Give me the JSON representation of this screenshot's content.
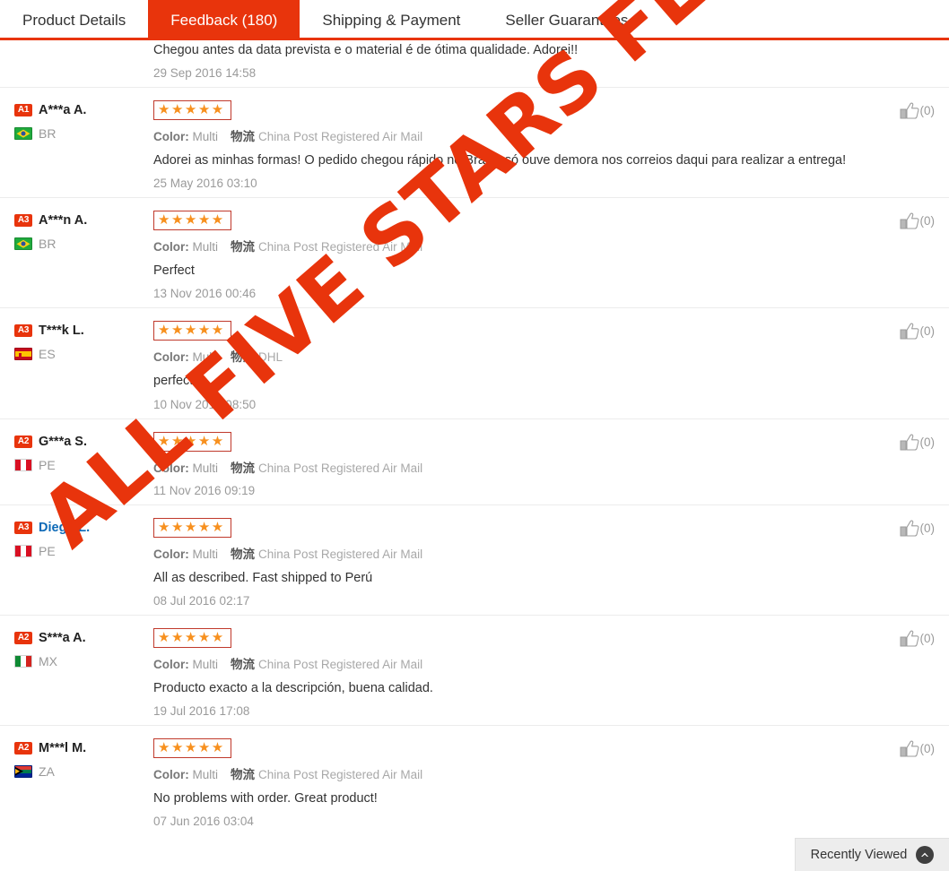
{
  "tabs": [
    {
      "label": "Product Details",
      "active": false
    },
    {
      "label": "Feedback (180)",
      "active": true
    },
    {
      "label": "Shipping & Payment",
      "active": false
    },
    {
      "label": "Seller Guarantees",
      "active": false
    }
  ],
  "watermark": {
    "text": "ALL FIVE STARS FEEEDBACK",
    "color": "#e8340c"
  },
  "recently_viewed": {
    "label": "Recently Viewed",
    "icon": "chevron-up-icon"
  },
  "accent_color": "#e8340c",
  "star_color": "#f7901e",
  "meta_labels": {
    "color_label": "Color:",
    "logistics_label": "物流"
  },
  "reviews": [
    {
      "partial": true,
      "badge": "",
      "user": "",
      "country": "",
      "flag": "",
      "stars": "",
      "color": "",
      "logistics": "",
      "text": "Chegou antes da data prevista e o material é de ótima qualidade. Adorei!!",
      "date": "29 Sep 2016 14:58",
      "helpful": ""
    },
    {
      "partial": false,
      "badge": "A1",
      "user": "A***a A.",
      "user_is_link": false,
      "country": "BR",
      "flag": "flag-br",
      "stars": "★★★★★",
      "color": "Multi",
      "logistics": "China Post Registered Air Mail",
      "text": "Adorei as minhas formas! O pedido chegou rápido no Brasil, só ouve demora nos correios daqui para realizar a entrega!",
      "date": "25 May 2016 03:10",
      "helpful": "(0)"
    },
    {
      "partial": false,
      "badge": "A3",
      "user": "A***n A.",
      "user_is_link": false,
      "country": "BR",
      "flag": "flag-br",
      "stars": "★★★★★",
      "color": "Multi",
      "logistics": "China Post Registered Air Mail",
      "text": "Perfect",
      "date": "13 Nov 2016 00:46",
      "helpful": "(0)"
    },
    {
      "partial": false,
      "badge": "A3",
      "user": "T***k L.",
      "user_is_link": false,
      "country": "ES",
      "flag": "flag-es",
      "stars": "★★★★★",
      "color": "Multi",
      "logistics": "DHL",
      "text": "perfect!",
      "date": "10 Nov 2016 08:50",
      "helpful": "(0)"
    },
    {
      "partial": false,
      "badge": "A2",
      "user": "G***a S.",
      "user_is_link": false,
      "country": "PE",
      "flag": "flag-pe",
      "stars": "★★★★★",
      "color": "Multi",
      "logistics": "China Post Registered Air Mail",
      "text": "",
      "date": "11 Nov 2016 09:19",
      "helpful": "(0)"
    },
    {
      "partial": false,
      "badge": "A3",
      "user": "Diego L.",
      "user_is_link": true,
      "country": "PE",
      "flag": "flag-pe",
      "stars": "★★★★★",
      "color": "Multi",
      "logistics": "China Post Registered Air Mail",
      "text": "All as described. Fast shipped to Perú",
      "date": "08 Jul 2016 02:17",
      "helpful": "(0)"
    },
    {
      "partial": false,
      "badge": "A2",
      "user": "S***a A.",
      "user_is_link": false,
      "country": "MX",
      "flag": "flag-mx",
      "stars": "★★★★★",
      "color": "Multi",
      "logistics": "China Post Registered Air Mail",
      "text": "Producto exacto a la descripción, buena calidad.",
      "date": "19 Jul 2016 17:08",
      "helpful": "(0)"
    },
    {
      "partial": false,
      "badge": "A2",
      "user": "M***l M.",
      "user_is_link": false,
      "country": "ZA",
      "flag": "flag-za",
      "stars": "★★★★★",
      "color": "Multi",
      "logistics": "China Post Registered Air Mail",
      "text": "No problems with order. Great product!",
      "date": "07 Jun 2016 03:04",
      "helpful": "(0)"
    }
  ]
}
